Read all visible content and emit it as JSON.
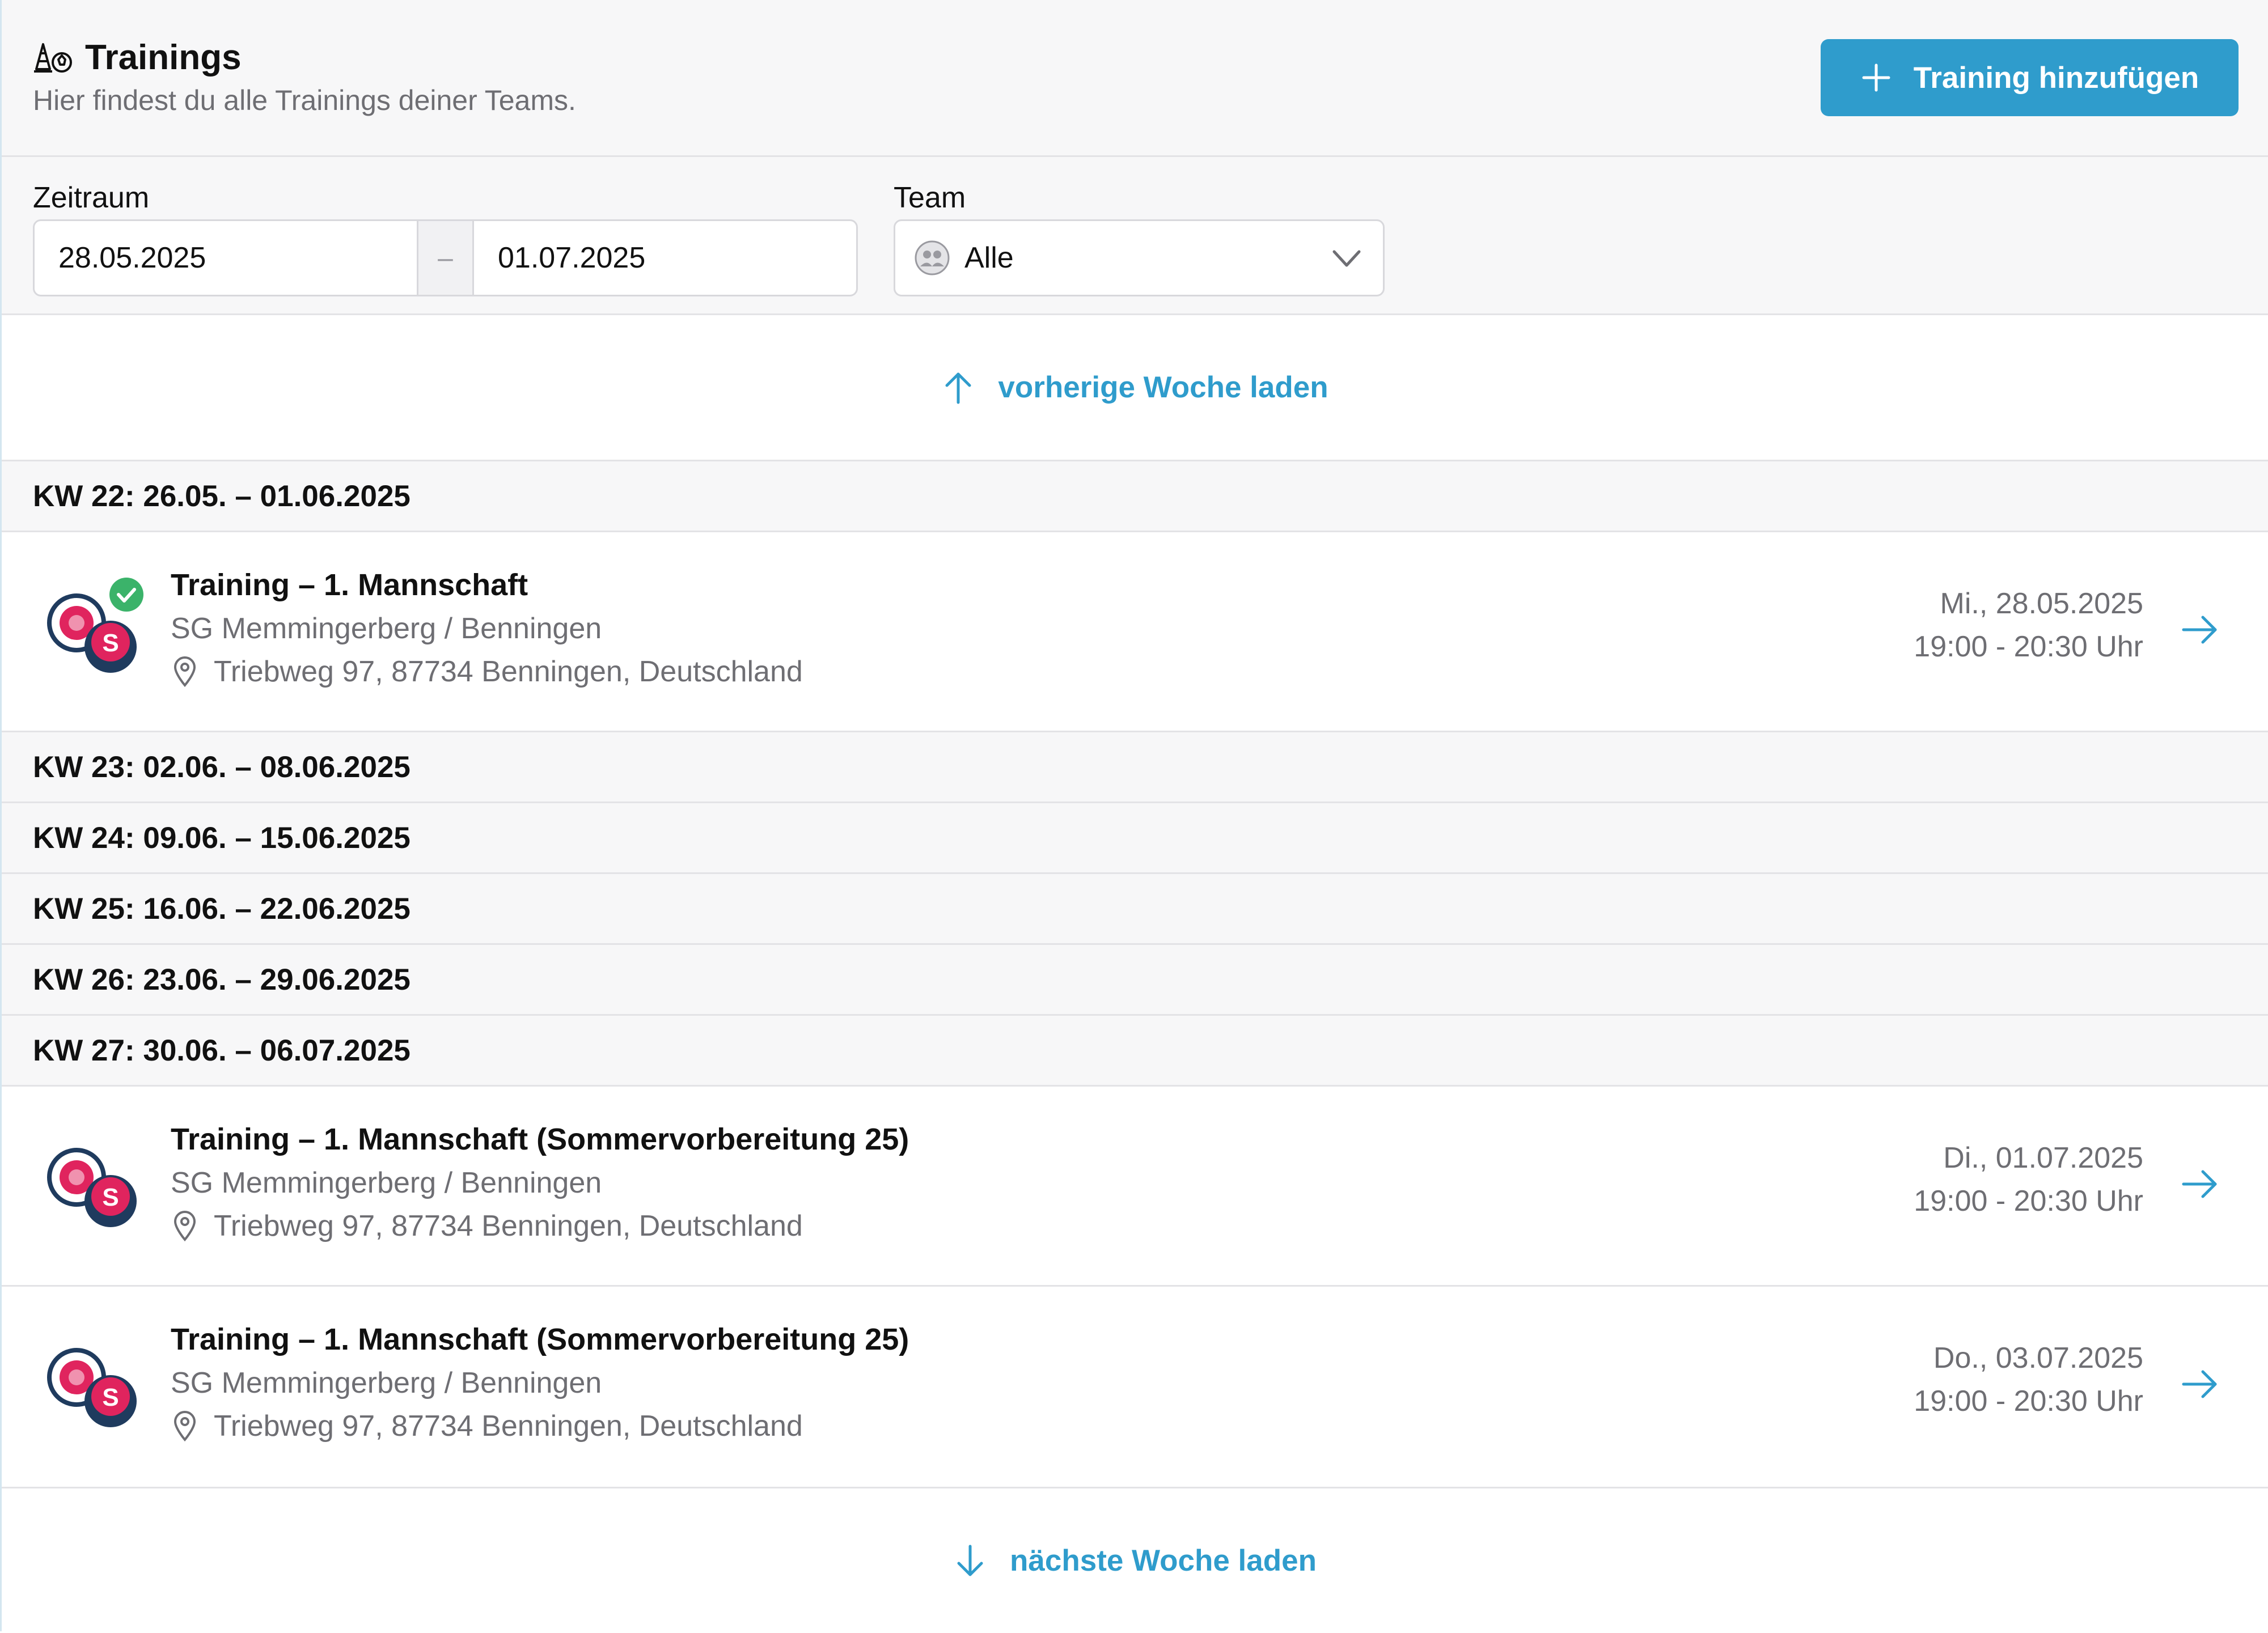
{
  "header": {
    "title": "Trainings",
    "subtitle": "Hier findest du alle Trainings deiner Teams.",
    "add_button_label": "Training hinzufügen"
  },
  "filters": {
    "period_label": "Zeitraum",
    "date_from": "28.05.2025",
    "date_separator": "–",
    "date_to": "01.07.2025",
    "team_label": "Team",
    "team_value": "Alle"
  },
  "load_previous_label": "vorherige Woche laden",
  "load_next_label": "nächste Woche laden",
  "weeks": [
    "KW 22: 26.05. – 01.06.2025",
    "KW 23: 02.06. – 08.06.2025",
    "KW 24: 09.06. – 15.06.2025",
    "KW 25: 16.06. – 22.06.2025",
    "KW 26: 23.06. – 29.06.2025",
    "KW 27: 30.06. – 06.07.2025"
  ],
  "trainings": [
    {
      "title": "Training – 1. Mannschaft",
      "club": "SG Memmingerberg / Benningen",
      "address": "Triebweg 97, 87734 Benningen, Deutschland",
      "date": "Mi., 28.05.2025",
      "time": "19:00 - 20:30 Uhr",
      "confirmed": true
    },
    {
      "title": "Training – 1. Mannschaft (Sommervorbereitung 25)",
      "club": "SG Memmingerberg / Benningen",
      "address": "Triebweg 97, 87734 Benningen, Deutschland",
      "date": "Di., 01.07.2025",
      "time": "19:00 - 20:30 Uhr",
      "confirmed": false
    },
    {
      "title": "Training – 1. Mannschaft (Sommervorbereitung 25)",
      "club": "SG Memmingerberg / Benningen",
      "address": "Triebweg 97, 87734 Benningen, Deutschland",
      "date": "Do., 03.07.2025",
      "time": "19:00 - 20:30 Uhr",
      "confirmed": false
    }
  ],
  "colors": {
    "accent": "#2f9ccc",
    "confirmed": "#3bb36a",
    "muted_text": "#6e6e73",
    "band_background": "#f7f7f8"
  },
  "icons": {
    "header": "training-cones-icon",
    "add": "plus-icon",
    "team": "people-icon",
    "dropdown": "chevron-down-icon",
    "previous": "arrow-up-icon",
    "next": "arrow-down-icon",
    "location": "map-pin-icon",
    "open": "arrow-right-icon",
    "confirmed": "check-circle-icon"
  }
}
